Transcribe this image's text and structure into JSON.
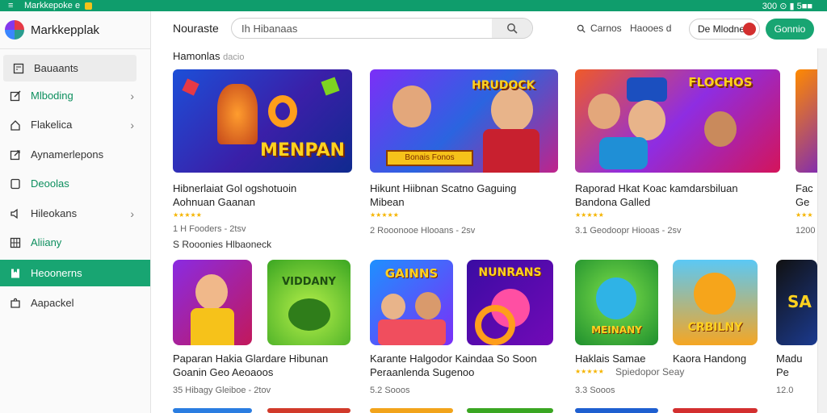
{
  "statusbar": {
    "title": "Markkepoke e",
    "right": "300 ⊙ ▮ 5■■"
  },
  "sidebar": {
    "brand": "Markkepplak",
    "brand_sub": "",
    "items": [
      {
        "label": "Bauaants",
        "icon": "calculator-icon"
      },
      {
        "label": "Mlboding",
        "icon": "edit-icon"
      },
      {
        "label": "Flakelica",
        "icon": "home-icon"
      },
      {
        "label": "Aynamerlepons",
        "icon": "share-icon"
      },
      {
        "label": "Deoolas",
        "icon": "tablet-icon"
      },
      {
        "label": "Hileokans",
        "icon": "speaker-icon"
      },
      {
        "label": "Aliiany",
        "icon": "grid-icon"
      },
      {
        "label": "Heoonerns",
        "icon": "bookmark-icon"
      },
      {
        "label": "Aapackel",
        "icon": "puzzle-icon"
      }
    ]
  },
  "toolbar": {
    "title": "Nouraste",
    "search_value": "Ih Hibanaas",
    "link1": "Carnos",
    "link2": "Haooes d",
    "mode": "De Mlodne",
    "cta": "Gonnio"
  },
  "section": {
    "title": "Hamonlas",
    "sub": "dacio"
  },
  "row1": [
    {
      "banner": "MENPAN",
      "title1": "Hibnerlaiat Gol ogshotuoin",
      "title2": "Aohnuan Gaanan",
      "meta": "1 H Fooders - 2tsv",
      "meta2": "S Rooonies Hlbaoneck"
    },
    {
      "banner": "Bonais Fonos",
      "title1": "Hikunt Hiibnan Scatno Gaguing",
      "title2": "Mibean",
      "meta": "2 Rooonooe Hlooans - 2sv"
    },
    {
      "banner": "FLOCHOS",
      "title1": "Raporad Hkat Koac kamdarsbiluan",
      "title2": "Bandona Galled",
      "meta": "3.1 Geodoopr Hiooas - 2sv"
    },
    {
      "banner": "",
      "title1": "Fac",
      "title2": "Ge",
      "meta": "1200"
    }
  ],
  "row2": [
    {
      "tile": "",
      "title1": "Paparan Hakia Glardare Hibunan",
      "title2": "Goanin Geo Aeoaoos",
      "meta": "35 Hibagy Gleiboe - 2tov"
    },
    {
      "tile": "VIDDANY",
      "title1": "",
      "title2": "",
      "meta": ""
    },
    {
      "tile": "GAINNS",
      "title1": "Karante Halgodor Kaindaa So Soon",
      "title2": "Peraanlenda Sugenoo",
      "meta": "5.2 Sooos"
    },
    {
      "tile": "NUNRANS",
      "title1": "",
      "title2": "",
      "meta": ""
    },
    {
      "tile": "MEINANY",
      "title1": "Haklais Samae",
      "title2": "Spiedopor Seay",
      "meta": "3.3 Sooos"
    },
    {
      "tile": "CRBILNY",
      "title1": "Kaora Handong",
      "title2": "",
      "meta": ""
    },
    {
      "tile": "SA",
      "title1": "Madu",
      "title2": "Pe",
      "meta": "12.0"
    }
  ],
  "colors": {
    "accent": "#18a572",
    "status": "#0f9d6c"
  }
}
